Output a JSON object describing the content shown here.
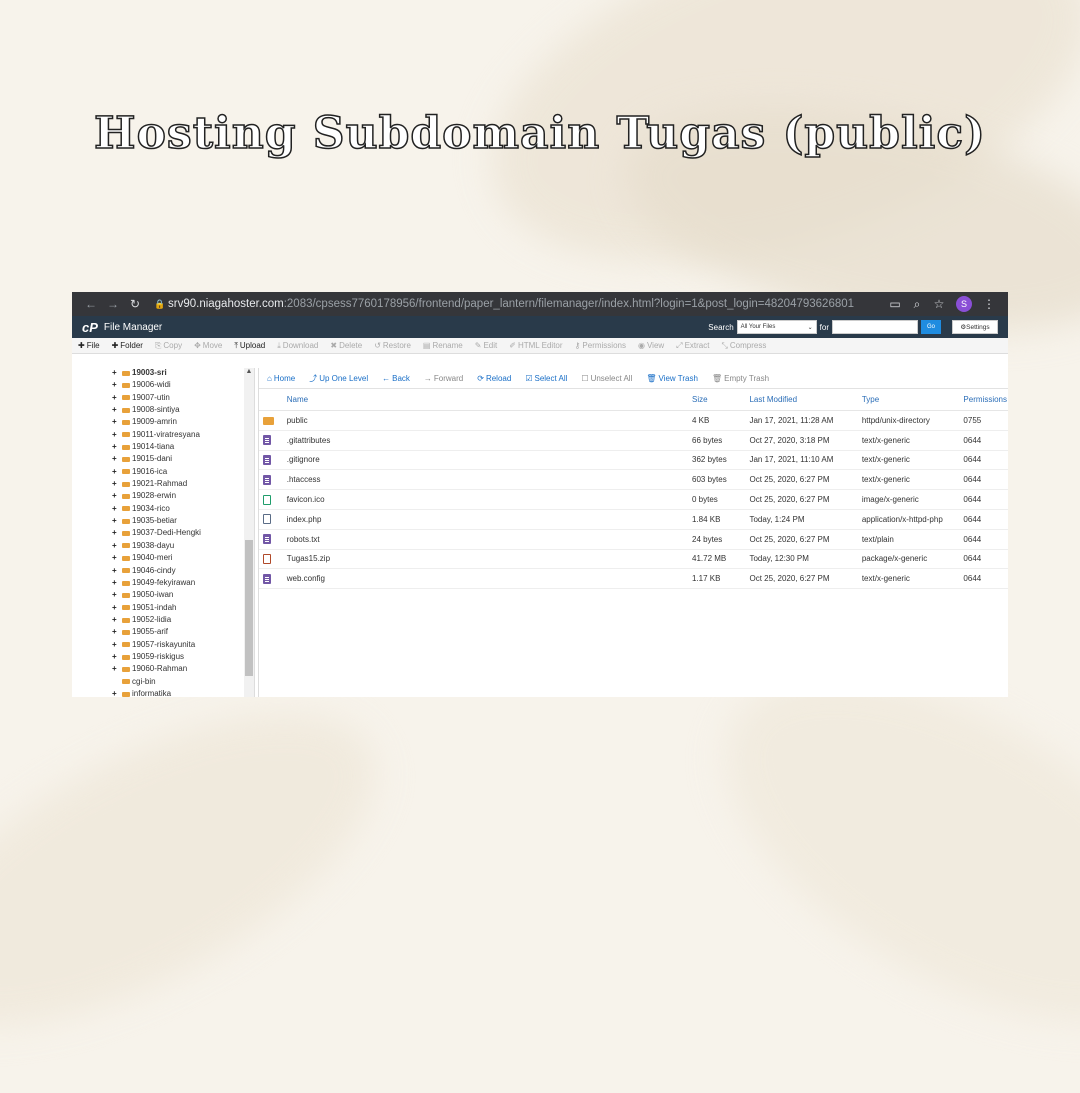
{
  "page": {
    "title": "Hosting Subdomain Tugas (public)"
  },
  "browser": {
    "url_host": "srv90.niagahoster.com",
    "url_rest": ":2083/cpsess7760178956/frontend/paper_lantern/filemanager/index.html?login=1&post_login=48204793626801",
    "avatar_letter": "S"
  },
  "cpanel": {
    "logo": "cP",
    "app_title": "File Manager",
    "search_label": "Search",
    "search_scope": "All Your Files",
    "for_label": "for",
    "go_label": "Go",
    "settings_label": "Settings"
  },
  "toolbar": [
    {
      "icon": "plus-icon",
      "label": "File",
      "enabled": true
    },
    {
      "icon": "plus-icon",
      "label": "Folder",
      "enabled": true
    },
    {
      "icon": "copy-icon",
      "label": "Copy",
      "enabled": false
    },
    {
      "icon": "move-icon",
      "label": "Move",
      "enabled": false
    },
    {
      "icon": "upload-icon",
      "label": "Upload",
      "enabled": true
    },
    {
      "icon": "download-icon",
      "label": "Download",
      "enabled": false
    },
    {
      "icon": "delete-icon",
      "label": "Delete",
      "enabled": false
    },
    {
      "icon": "restore-icon",
      "label": "Restore",
      "enabled": false
    },
    {
      "icon": "rename-icon",
      "label": "Rename",
      "enabled": false
    },
    {
      "icon": "edit-icon",
      "label": "Edit",
      "enabled": false
    },
    {
      "icon": "html-editor-icon",
      "label": "HTML Editor",
      "enabled": false
    },
    {
      "icon": "key-icon",
      "label": "Permissions",
      "enabled": false
    },
    {
      "icon": "eye-icon",
      "label": "View",
      "enabled": false
    },
    {
      "icon": "extract-icon",
      "label": "Extract",
      "enabled": false
    },
    {
      "icon": "compress-icon",
      "label": "Compress",
      "enabled": false
    }
  ],
  "navbar": [
    {
      "icon": "home-icon",
      "glyph": "⌂",
      "label": "Home",
      "enabled": true
    },
    {
      "icon": "up-level-icon",
      "glyph": "⤴",
      "label": "Up One Level",
      "enabled": true
    },
    {
      "icon": "back-icon",
      "glyph": "←",
      "label": "Back",
      "enabled": true
    },
    {
      "icon": "forward-icon",
      "glyph": "→",
      "label": "Forward",
      "enabled": false
    },
    {
      "icon": "reload-icon",
      "glyph": "⟳",
      "label": "Reload",
      "enabled": true
    },
    {
      "icon": "select-all-icon",
      "glyph": "☑",
      "label": "Select All",
      "enabled": true
    },
    {
      "icon": "unselect-all-icon",
      "glyph": "☐",
      "label": "Unselect All",
      "enabled": false
    },
    {
      "icon": "trash-icon",
      "glyph": "🗑",
      "label": "View Trash",
      "enabled": true
    },
    {
      "icon": "trash-icon",
      "glyph": "🗑",
      "label": "Empty Trash",
      "enabled": false
    }
  ],
  "tree": [
    {
      "label": "19003-sri",
      "bold": true,
      "expand": true
    },
    {
      "label": "19006-widi",
      "expand": true
    },
    {
      "label": "19007-utin",
      "expand": true
    },
    {
      "label": "19008-sintiya",
      "expand": true
    },
    {
      "label": "19009-amrin",
      "expand": true
    },
    {
      "label": "19011-viratresyana",
      "expand": true
    },
    {
      "label": "19014-tiana",
      "expand": true
    },
    {
      "label": "19015-dani",
      "expand": true
    },
    {
      "label": "19016-ica",
      "expand": true
    },
    {
      "label": "19021-Rahmad",
      "expand": true
    },
    {
      "label": "19028-erwin",
      "expand": true
    },
    {
      "label": "19034-rico",
      "expand": true
    },
    {
      "label": "19035-betiar",
      "expand": true
    },
    {
      "label": "19037-Dedi-Hengki",
      "expand": true
    },
    {
      "label": "19038-dayu",
      "expand": true
    },
    {
      "label": "19040-meri",
      "expand": true
    },
    {
      "label": "19046-cindy",
      "expand": true
    },
    {
      "label": "19049-fekyirawan",
      "expand": true
    },
    {
      "label": "19050-iwan",
      "expand": true
    },
    {
      "label": "19051-indah",
      "expand": true
    },
    {
      "label": "19052-lidia",
      "expand": true
    },
    {
      "label": "19055-arif",
      "expand": true
    },
    {
      "label": "19057-riskayunita",
      "expand": true
    },
    {
      "label": "19059-riskigus",
      "expand": true
    },
    {
      "label": "19060-Rahman",
      "expand": true
    },
    {
      "label": "cgi-bin",
      "expand": false
    },
    {
      "label": "informatika",
      "expand": true,
      "outdent": true
    }
  ],
  "table": {
    "headers": [
      "Name",
      "Size",
      "Last Modified",
      "Type",
      "Permissions"
    ],
    "rows": [
      {
        "icon": "folder",
        "name": "public",
        "size": "4 KB",
        "modified": "Jan 17, 2021, 11:28 AM",
        "type": "httpd/unix-directory",
        "perm": "0755"
      },
      {
        "icon": "text",
        "name": ".gitattributes",
        "size": "66 bytes",
        "modified": "Oct 27, 2020, 3:18 PM",
        "type": "text/x-generic",
        "perm": "0644"
      },
      {
        "icon": "text",
        "name": ".gitignore",
        "size": "362 bytes",
        "modified": "Jan 17, 2021, 11:10 AM",
        "type": "text/x-generic",
        "perm": "0644"
      },
      {
        "icon": "text",
        "name": ".htaccess",
        "size": "603 bytes",
        "modified": "Oct 25, 2020, 6:27 PM",
        "type": "text/x-generic",
        "perm": "0644"
      },
      {
        "icon": "image",
        "name": "favicon.ico",
        "size": "0 bytes",
        "modified": "Oct 25, 2020, 6:27 PM",
        "type": "image/x-generic",
        "perm": "0644"
      },
      {
        "icon": "code",
        "name": "index.php",
        "size": "1.84 KB",
        "modified": "Today, 1:24 PM",
        "type": "application/x-httpd-php",
        "perm": "0644"
      },
      {
        "icon": "text",
        "name": "robots.txt",
        "size": "24 bytes",
        "modified": "Oct 25, 2020, 6:27 PM",
        "type": "text/plain",
        "perm": "0644"
      },
      {
        "icon": "zip",
        "name": "Tugas15.zip",
        "size": "41.72 MB",
        "modified": "Today, 12:30 PM",
        "type": "package/x-generic",
        "perm": "0644"
      },
      {
        "icon": "text",
        "name": "web.config",
        "size": "1.17 KB",
        "modified": "Oct 25, 2020, 6:27 PM",
        "type": "text/x-generic",
        "perm": "0644"
      }
    ]
  }
}
